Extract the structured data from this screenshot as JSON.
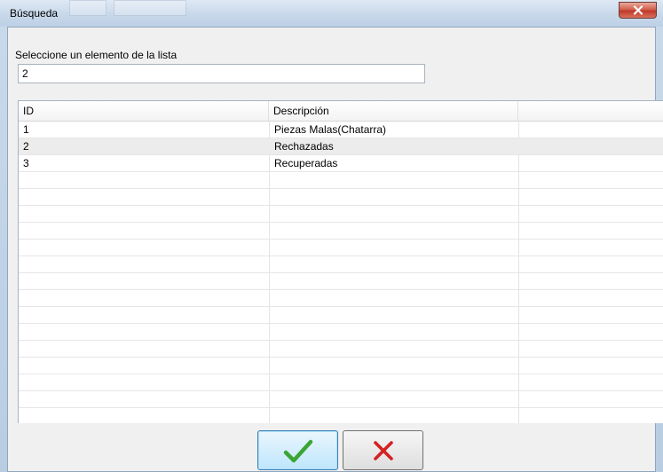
{
  "window": {
    "title": "Búsqueda"
  },
  "search": {
    "label": "Seleccione un elemento de la lista",
    "value": "2"
  },
  "grid": {
    "columns": [
      "ID",
      "Descripción",
      ""
    ],
    "rows": [
      {
        "id": "1",
        "descripcion": "Piezas Malas(Chatarra)"
      },
      {
        "id": "2",
        "descripcion": "Rechazadas"
      },
      {
        "id": "3",
        "descripcion": "Recuperadas"
      }
    ],
    "selected_id": "2"
  },
  "buttons": {
    "ok_icon": "checkmark-icon",
    "cancel_icon": "cross-icon"
  },
  "colors": {
    "ok_green": "#3aa534",
    "cancel_red": "#d42222",
    "close_red": "#c0392b"
  }
}
